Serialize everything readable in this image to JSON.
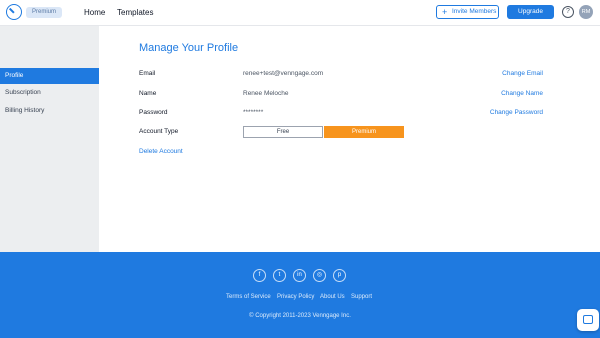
{
  "header": {
    "badge": "Premium",
    "nav": {
      "home": "Home",
      "templates": "Templates"
    },
    "invite_label": "Invite Members",
    "invite_icon": "+",
    "upgrade_label": "Upgrade",
    "help_label": "?",
    "avatar_initials": "RM"
  },
  "sidebar": {
    "items": [
      {
        "label": "Profile",
        "active": true
      },
      {
        "label": "Subscription",
        "active": false
      },
      {
        "label": "Billing History",
        "active": false
      }
    ]
  },
  "main": {
    "title": "Manage Your Profile",
    "rows": [
      {
        "label": "Email",
        "value": "renee+test@venngage.com",
        "action": "Change Email"
      },
      {
        "label": "Name",
        "value": "Renee Meloche",
        "action": "Change Name"
      },
      {
        "label": "Password",
        "value": "********",
        "action": "Change Password"
      },
      {
        "label": "Account Type"
      }
    ],
    "account_type": {
      "options": [
        "Free",
        "Premium"
      ],
      "selected": "Premium"
    },
    "delete_label": "Delete Account"
  },
  "footer": {
    "social": [
      {
        "icon": "facebook-icon",
        "glyph": "f"
      },
      {
        "icon": "twitter-icon",
        "glyph": "t"
      },
      {
        "icon": "linkedin-icon",
        "glyph": "in"
      },
      {
        "icon": "instagram-icon",
        "glyph": "◎"
      },
      {
        "icon": "pinterest-icon",
        "glyph": "p"
      }
    ],
    "links": [
      "Terms of Service",
      "Privacy Policy",
      "About Us",
      "Support"
    ],
    "copyright": "© Copyright 2011-2023 Venngage Inc."
  },
  "colors": {
    "accent": "#1f7ae0",
    "premium": "#f7941d",
    "sidebar_bg": "#eceef0"
  }
}
